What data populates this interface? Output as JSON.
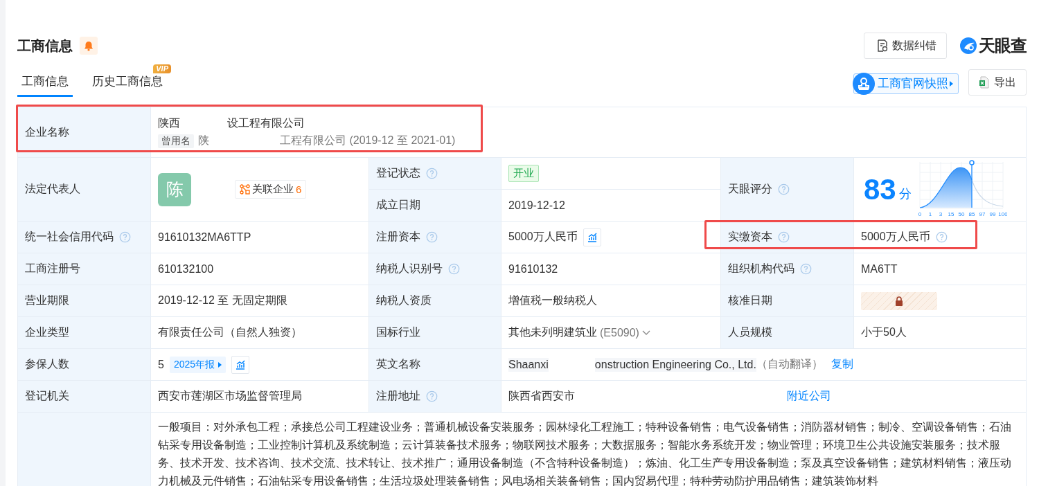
{
  "header": {
    "title": "工商信息",
    "feedback_button": "数据纠错",
    "logo": "天眼查"
  },
  "tabs": [
    {
      "label": "工商信息",
      "selected": true
    },
    {
      "label": "历史工商信息",
      "selected": false,
      "badge": "VIP"
    }
  ],
  "toolbar": {
    "snapshot_button": "工商官网快照",
    "export_button": "导出"
  },
  "table": {
    "company_name": {
      "label": "企业名称",
      "value_parts": [
        "陕西",
        "设工程有限公司"
      ],
      "former_tag": "曾用名",
      "former_parts": [
        "陕",
        "工程有限公司 (2019-12 至 2021-01)"
      ],
      "highlighted": true
    },
    "legal_rep": {
      "label": "法定代表人",
      "avatar": "陈",
      "related_label": "关联企业",
      "related_count": "6"
    },
    "status": {
      "label": "登记状态",
      "help": true,
      "value": "开业"
    },
    "founded": {
      "label": "成立日期",
      "help": false,
      "value": "2019-12-12"
    },
    "score": {
      "label": "天眼评分",
      "help": true,
      "value": "83",
      "unit": "分",
      "ticks": [
        "0",
        "1",
        "3",
        "15",
        "50",
        "85",
        "97",
        "99",
        "100"
      ]
    },
    "rows": [
      {
        "cells": [
          {
            "label": "统一社会信用代码",
            "help": true,
            "kind": "text",
            "value": "91610132MA6TTP",
            "highlighted": false
          },
          {
            "label": "注册资本",
            "help": true,
            "kind": "money_trend",
            "value": "5000万人民币",
            "highlighted": false
          },
          {
            "label": "实缴资本",
            "help": true,
            "kind": "text_help",
            "value": "5000万人民币",
            "highlighted": true
          }
        ]
      },
      {
        "cells": [
          {
            "label": "工商注册号",
            "help": false,
            "kind": "text",
            "value": "610132100",
            "highlighted": false
          },
          {
            "label": "纳税人识别号",
            "help": true,
            "kind": "text",
            "value": "91610132",
            "highlighted": false
          },
          {
            "label": "组织机构代码",
            "help": true,
            "kind": "text",
            "value": "MA6TT",
            "highlighted": false
          }
        ]
      },
      {
        "cells": [
          {
            "label": "营业期限",
            "help": false,
            "kind": "text",
            "value": "2019-12-12 至 无固定期限",
            "highlighted": false
          },
          {
            "label": "纳税人资质",
            "help": false,
            "kind": "text",
            "value": "增值税一般纳税人",
            "highlighted": false
          },
          {
            "label": "核准日期",
            "help": false,
            "kind": "locked",
            "highlighted": false
          }
        ]
      },
      {
        "cells": [
          {
            "label": "企业类型",
            "help": false,
            "kind": "text",
            "value": "有限责任公司（自然人独资）",
            "highlighted": false
          },
          {
            "label": "国标行业",
            "help": false,
            "kind": "industry",
            "value": "其他未列明建筑业",
            "code": "(E5090)",
            "highlighted": false
          },
          {
            "label": "人员规模",
            "help": false,
            "kind": "text",
            "value": "小于50人",
            "highlighted": false
          }
        ]
      },
      {
        "cells": [
          {
            "label": "参保人数",
            "help": false,
            "kind": "insured",
            "value": "5",
            "report": "2025年报",
            "highlighted": false
          },
          {
            "label": "英文名称",
            "help": false,
            "kind": "english",
            "value_parts": [
              "Shaanxi",
              "onstruction Engineering Co., Ltd."
            ],
            "note": "（自动翻译）",
            "link": "复制",
            "highlighted": false
          }
        ]
      },
      {
        "cells": [
          {
            "label": "登记机关",
            "help": false,
            "kind": "text",
            "value": "西安市莲湖区市场监督管理局",
            "highlighted": false
          },
          {
            "label": "注册地址",
            "help": true,
            "kind": "address",
            "value": "陕西省西安市",
            "link": "附近公司",
            "highlighted": false
          }
        ]
      }
    ],
    "scope": {
      "value": "一般项目：对外承包工程；承接总公司工程建设业务；普通机械设备安装服务；园林绿化工程施工；特种设备销售；电气设备销售；消防器材销售；制冷、空调设备销售；石油钻采专用设备制造；工业控制计算机及系统制造；云计算装备技术服务；物联网技术服务；大数据服务；智能水务系统开发；物业管理；环境卫生公共设施安装服务；技术服务、技术开发、技术咨询、技术交流、技术转让、技术推广；通用设备制造（不含特种设备制造）；炼油、化工生产专用设备制造；泵及真空设备销售；建筑材料销售；液压动力机械及元件销售；石油钻采专用设备销售；生活垃圾处理装备销售；风电场相关装备销售；国内贸易代理；特种劳动防护用品销售；建筑装饰材料"
    }
  }
}
